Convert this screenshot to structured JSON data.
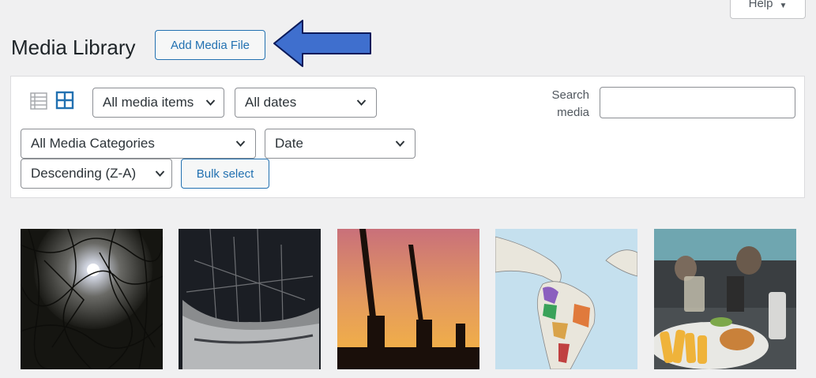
{
  "header": {
    "help_label": "Help",
    "title": "Media Library",
    "add_label": "Add Media File"
  },
  "filters": {
    "type_value": "All media items",
    "dates_value": "All dates",
    "category_value": "All Media Categories",
    "orderby_value": "Date",
    "order_value": "Descending (Z-A)",
    "bulk_label": "Bulk select",
    "search_label_line1": "Search",
    "search_label_line2": "media",
    "search_value": ""
  },
  "icons": {
    "list_view": "list-view-icon",
    "grid_view": "grid-view-icon",
    "help_caret": "chevron-down-icon",
    "annotation": "arrow-left-icon"
  },
  "colors": {
    "accent": "#2271b1",
    "arrow": "#3f6fce",
    "background": "#f0f0f1"
  },
  "media_items": [
    {
      "subject": "moon-through-branches"
    },
    {
      "subject": "historic-ship"
    },
    {
      "subject": "cranes-at-sunset"
    },
    {
      "subject": "map-of-latin-america"
    },
    {
      "subject": "food-in-restaurant"
    }
  ]
}
